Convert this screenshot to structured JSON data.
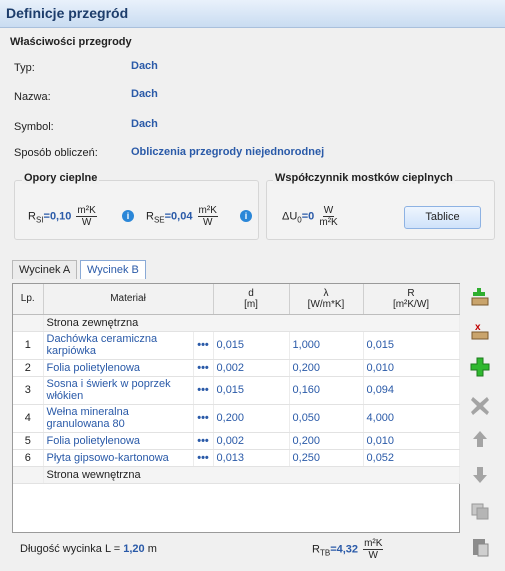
{
  "window": {
    "title": "Definicje przegród"
  },
  "props": {
    "section_title": "Właściwości przegrody",
    "type_label": "Typ:",
    "type_value": "Dach",
    "name_label": "Nazwa:",
    "name_value": "Dach",
    "symbol_label": "Symbol:",
    "symbol_value": "Dach",
    "method_label": "Sposób obliczeń:",
    "method_value": "Obliczenia przegrody niejednorodnej"
  },
  "resistance": {
    "title": "Opory cieplne",
    "rsi_label": "R",
    "rsi_sub": "SI",
    "rsi_value": "=0,10",
    "rse_label": "R",
    "rse_sub": "SE",
    "rse_value": "=0,04",
    "unit_num": "m²K",
    "unit_den": "W"
  },
  "bridges": {
    "title": "Współczynnik mostków cieplnych",
    "du_label": "ΔU",
    "du_sub": "0",
    "du_value": "=0",
    "unit_num": "W",
    "unit_den": "m²K",
    "button": "Tablice"
  },
  "tabs": [
    "Wycinek A",
    "Wycinek B"
  ],
  "table": {
    "headers": {
      "lp": "Lp.",
      "material": "Materiał",
      "d": "d",
      "d_unit": "[m]",
      "lambda": "λ",
      "lambda_unit": "[W/m*K]",
      "r": "R",
      "r_unit": "[m²K/W]"
    },
    "outer": "Strona zewnętrzna",
    "inner": "Strona wewnętrzna",
    "rows": [
      {
        "lp": "1",
        "material": "Dachówka ceramiczna karpiówka",
        "d": "0,015",
        "lambda": "1,000",
        "r": "0,015"
      },
      {
        "lp": "2",
        "material": "Folia polietylenowa",
        "d": "0,002",
        "lambda": "0,200",
        "r": "0,010"
      },
      {
        "lp": "3",
        "material": "Sosna i świerk w poprzek włókien",
        "d": "0,015",
        "lambda": "0,160",
        "r": "0,094"
      },
      {
        "lp": "4",
        "material": "Wełna mineralna granulowana 80",
        "d": "0,200",
        "lambda": "0,050",
        "r": "4,000"
      },
      {
        "lp": "5",
        "material": "Folia polietylenowa",
        "d": "0,002",
        "lambda": "0,200",
        "r": "0,010"
      },
      {
        "lp": "6",
        "material": "Płyta gipsowo-kartonowa",
        "d": "0,013",
        "lambda": "0,250",
        "r": "0,052"
      }
    ],
    "dots": "•••"
  },
  "footer": {
    "length_label": "Długość wycinka L =",
    "length_value": "1,20",
    "length_unit": "m",
    "rtb_label": "R",
    "rtb_sub": "TB",
    "rtb_value": "=4,32",
    "unit_num": "m²K",
    "unit_den": "W"
  }
}
